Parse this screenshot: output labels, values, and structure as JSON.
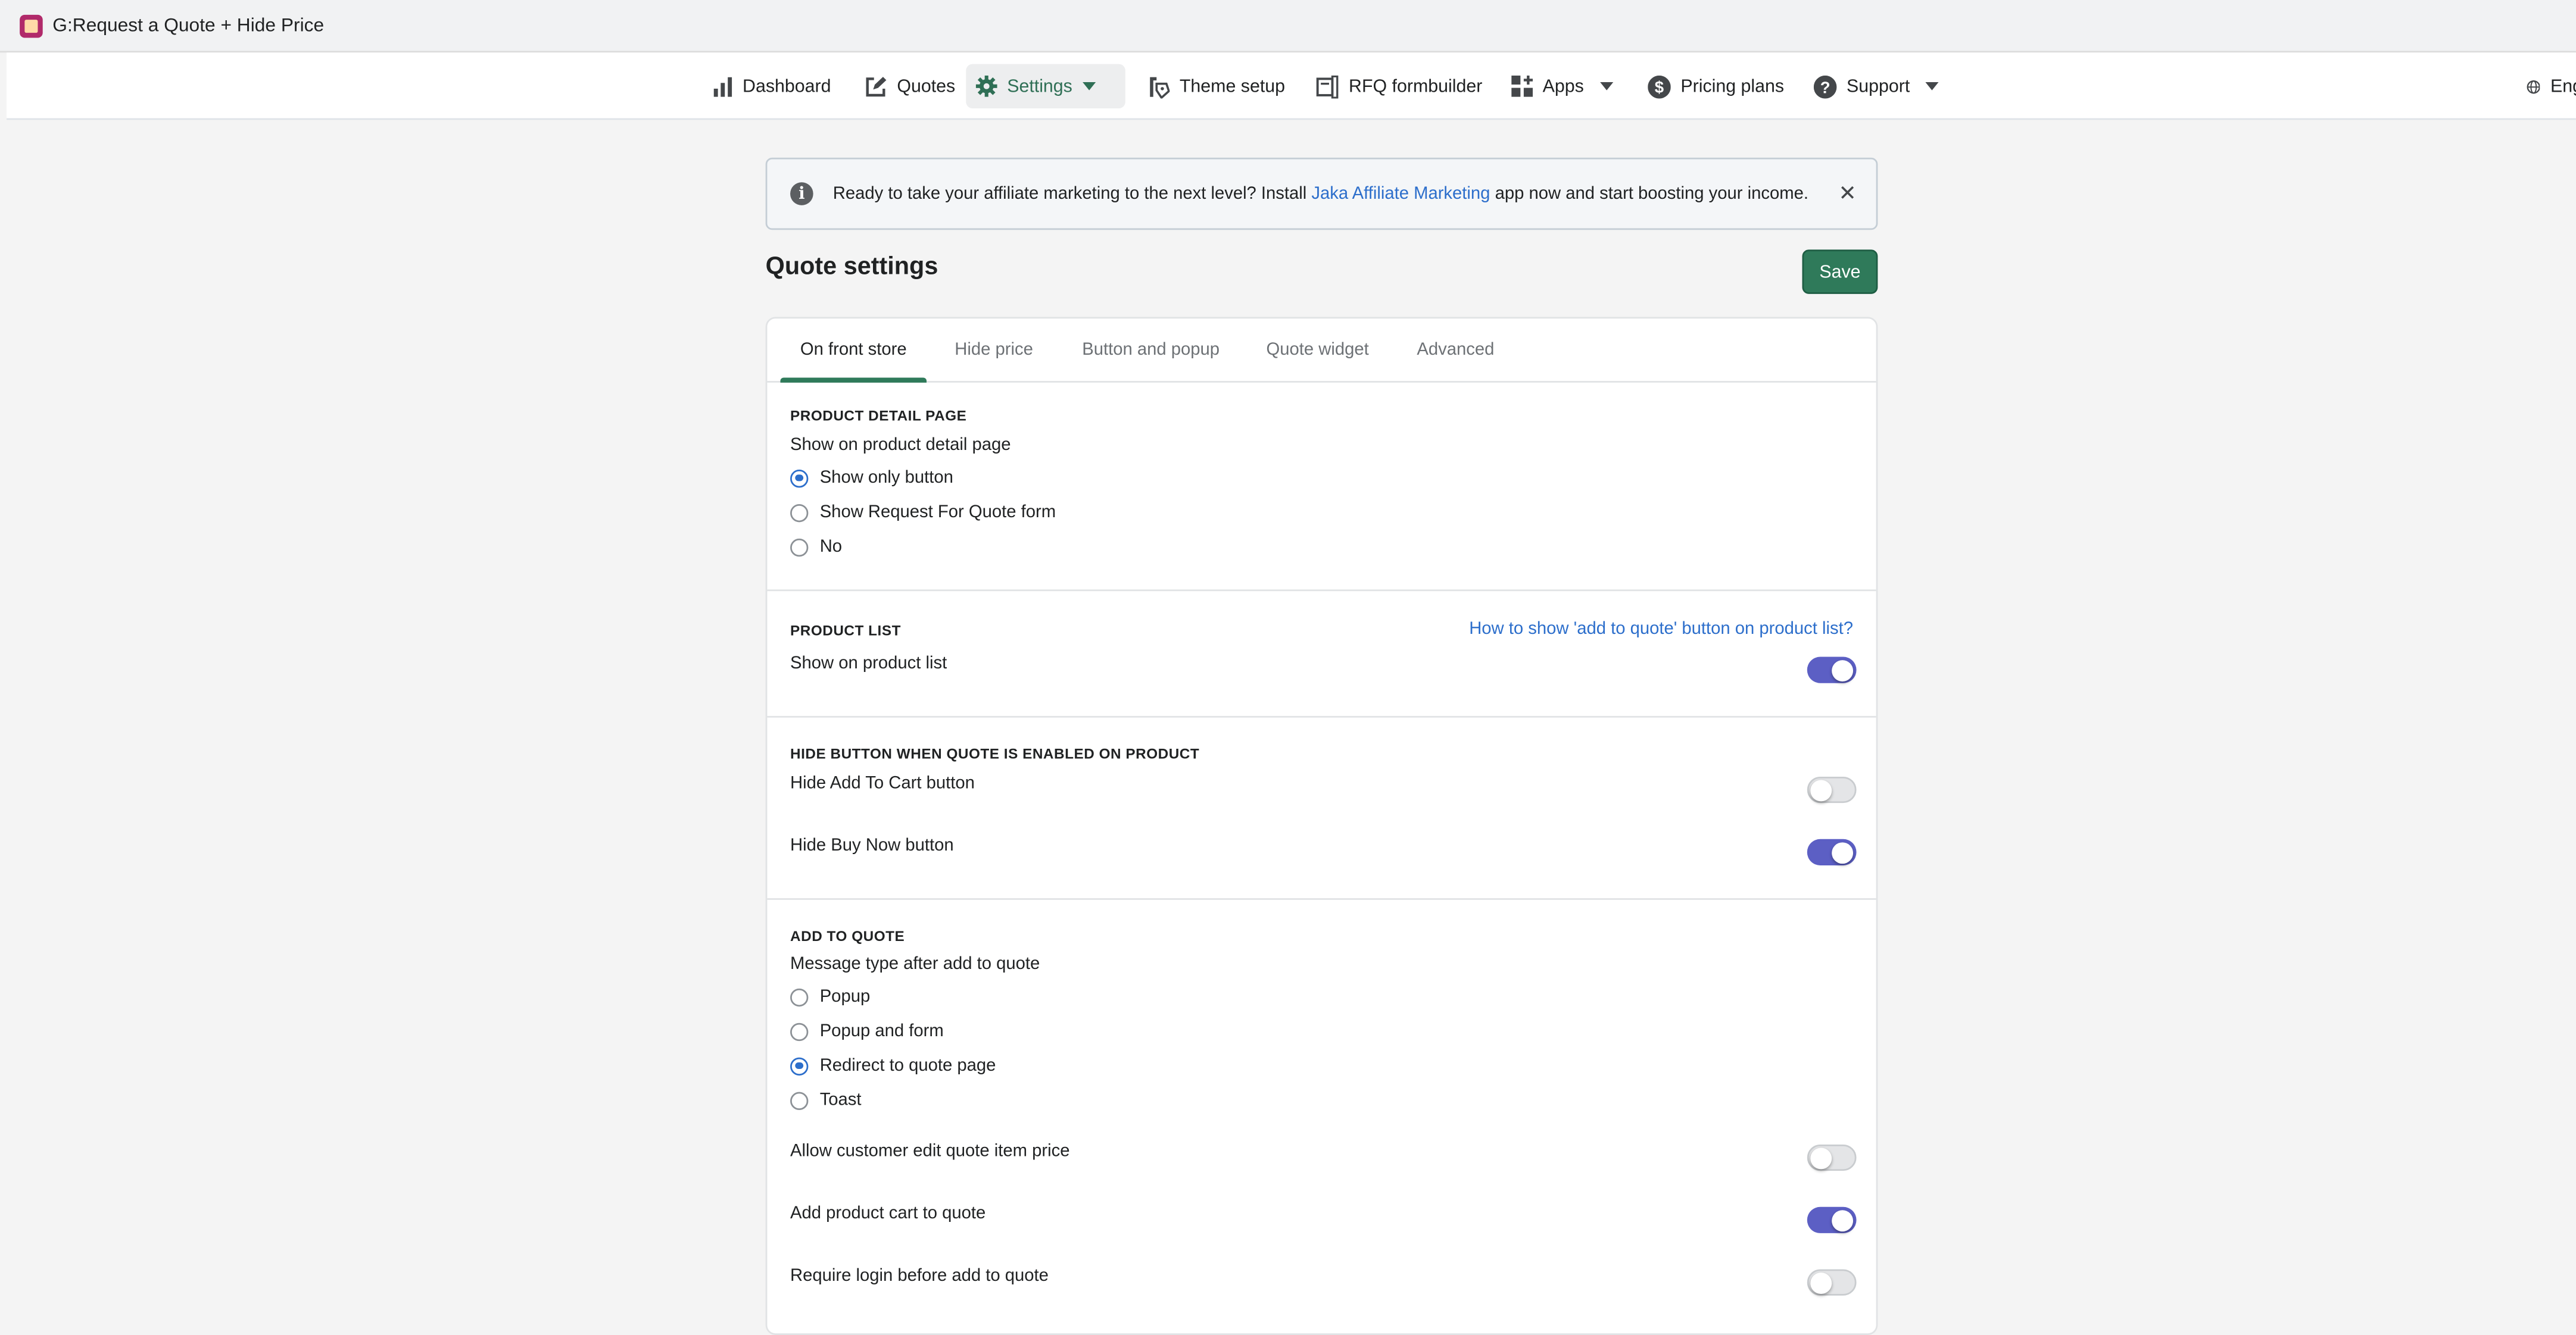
{
  "window": {
    "title": "G:Request a Quote + Hide Price"
  },
  "nav": {
    "items": [
      {
        "label": "Dashboard"
      },
      {
        "label": "Quotes"
      },
      {
        "label": "Settings"
      },
      {
        "label": "Theme setup"
      },
      {
        "label": "RFQ formbuilder"
      },
      {
        "label": "Apps"
      },
      {
        "label": "Pricing plans"
      },
      {
        "label": "Support"
      },
      {
        "label": "Eng"
      }
    ],
    "active": "Settings"
  },
  "banner": {
    "text_before": "Ready to take your affiliate marketing to the next level? Install ",
    "link": "Jaka Affiliate Marketing",
    "text_after": " app now and start boosting your income."
  },
  "page": {
    "title": "Quote settings",
    "save_label": "Save"
  },
  "tabs": [
    {
      "label": "On front store"
    },
    {
      "label": "Hide price"
    },
    {
      "label": "Button and popup"
    },
    {
      "label": "Quote widget"
    },
    {
      "label": "Advanced"
    }
  ],
  "product_detail": {
    "title": "PRODUCT DETAIL PAGE",
    "label": "Show on product detail page",
    "options": [
      "Show only button",
      "Show Request For Quote form",
      "No"
    ],
    "selected": "Show only button"
  },
  "product_list": {
    "title": "PRODUCT LIST",
    "help_link": "How to show 'add to quote' button on product list?",
    "label": "Show on product list",
    "enabled": true
  },
  "hide_button": {
    "title": "HIDE BUTTON WHEN QUOTE IS ENABLED ON PRODUCT",
    "hide_add_to_cart": {
      "label": "Hide Add To Cart button",
      "enabled": false
    },
    "hide_buy_now": {
      "label": "Hide Buy Now button",
      "enabled": true
    }
  },
  "add_to_quote": {
    "title": "ADD TO QUOTE",
    "label": "Message type after add to quote",
    "options": [
      "Popup",
      "Popup and form",
      "Redirect to quote page",
      "Toast"
    ],
    "selected": "Redirect to quote page",
    "allow_edit_price": {
      "label": "Allow customer edit quote item price",
      "enabled": false
    },
    "add_product_cart": {
      "label": "Add product cart to quote",
      "enabled": true
    },
    "require_login": {
      "label": "Require login before add to quote",
      "enabled": false
    }
  },
  "colors": {
    "accent_green": "#2f7a5a",
    "toggle_on": "#5c5fc4",
    "link_blue": "#2c6ecb"
  }
}
